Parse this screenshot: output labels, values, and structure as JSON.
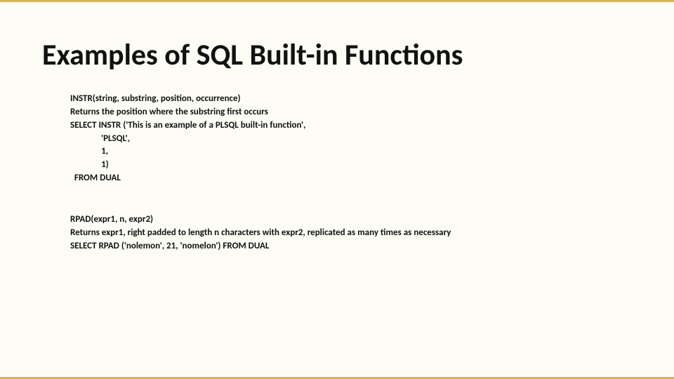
{
  "title": "Examples of SQL Built-in Functions",
  "block1": {
    "sig": "INSTR(string, substring, position, occurrence)",
    "desc": "Returns the position where the substring first occurs",
    "code1": "SELECT INSTR ('This is an example of a PLSQL built-in function',",
    "code2": "               'PLSQL',",
    "code3": "               1,",
    "code4": "               1)",
    "code5": "  FROM DUAL"
  },
  "block2": {
    "sig": "RPAD(expr1, n, expr2)",
    "desc": "Returns expr1, right padded to length n characters with expr2, replicated as many times as necessary",
    "code1": "SELECT RPAD ('nolemon', 21, 'nomelon') FROM DUAL"
  }
}
